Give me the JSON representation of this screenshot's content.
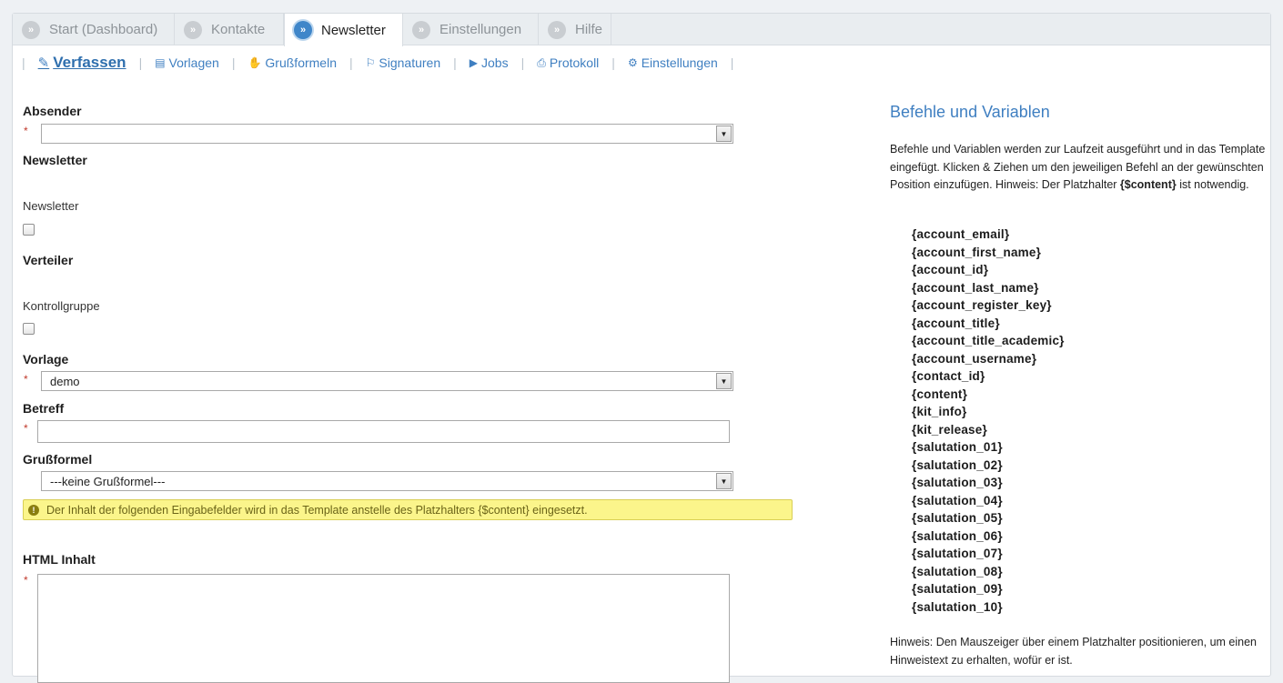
{
  "tabs": [
    {
      "label": "Start (Dashboard)"
    },
    {
      "label": "Kontakte"
    },
    {
      "label": "Newsletter"
    },
    {
      "label": "Einstellungen"
    },
    {
      "label": "Hilfe"
    }
  ],
  "tab_arrow": "»",
  "subnav": [
    {
      "label": "Verfassen",
      "icon": "edit-icon",
      "glyph": "✎"
    },
    {
      "label": "Vorlagen",
      "icon": "template-icon",
      "glyph": "▤"
    },
    {
      "label": "Grußformeln",
      "icon": "hand-icon",
      "glyph": "✋"
    },
    {
      "label": "Signaturen",
      "icon": "bookmark-icon",
      "glyph": "⚐"
    },
    {
      "label": "Jobs",
      "icon": "play-icon",
      "glyph": "▶"
    },
    {
      "label": "Protokoll",
      "icon": "print-icon",
      "glyph": "⎙"
    },
    {
      "label": "Einstellungen",
      "icon": "gears-icon",
      "glyph": "⚙"
    }
  ],
  "separator": "|",
  "form": {
    "absender_label": "Absender",
    "absender_value": "",
    "newsletter_heading": "Newsletter",
    "newsletter_checkbox_label": "Newsletter",
    "verteiler_heading": "Verteiler",
    "kontrollgruppe_label": "Kontrollgruppe",
    "vorlage_label": "Vorlage",
    "vorlage_value": "demo",
    "betreff_label": "Betreff",
    "betreff_value": "",
    "grussformel_label": "Grußformel",
    "grussformel_value": "---keine Grußformel---",
    "notice": "Der Inhalt der folgenden Eingabefelder wird in das Template anstelle des Platzhalters {$content} eingesetzt.",
    "html_label": "HTML Inhalt",
    "required_mark": "*"
  },
  "right_panel": {
    "title": "Befehle und Variablen",
    "desc_part1": "Befehle und Variablen werden zur Laufzeit ausgeführt und in das Template eingefügt. Klicken & Ziehen um den jeweiligen Befehl an der gewünschten Position einzufügen. Hinweis: Der Platzhalter ",
    "desc_bold": "{$content}",
    "desc_part2": " ist notwendig.",
    "variables": [
      "{account_email}",
      "{account_first_name}",
      "{account_id}",
      "{account_last_name}",
      "{account_register_key}",
      "{account_title}",
      "{account_title_academic}",
      "{account_username}",
      "{contact_id}",
      "{content}",
      "{kit_info}",
      "{kit_release}",
      "{salutation_01}",
      "{salutation_02}",
      "{salutation_03}",
      "{salutation_04}",
      "{salutation_05}",
      "{salutation_06}",
      "{salutation_07}",
      "{salutation_08}",
      "{salutation_09}",
      "{salutation_10}"
    ],
    "hint": "Hinweis: Den Mauszeiger über einem Platzhalter positionieren, um einen Hinweistext zu erhalten, wofür er ist."
  },
  "colors": {
    "accent": "#3f7fc1",
    "notice_bg": "#fbf58b",
    "required": "#c0392b"
  }
}
